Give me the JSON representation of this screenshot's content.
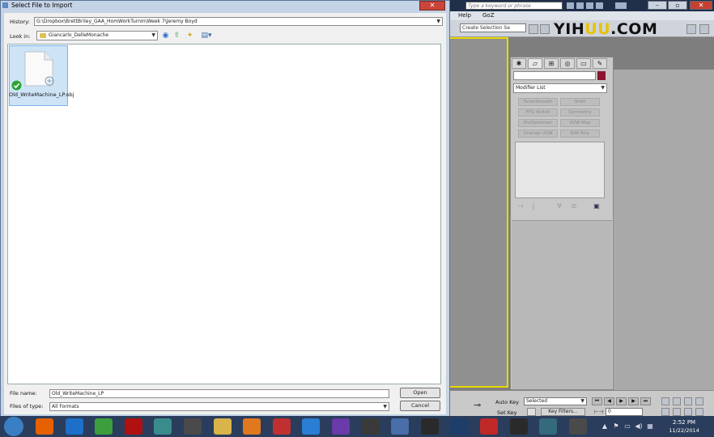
{
  "app": {
    "search_placeholder": "Type a keyword or phrase",
    "menu": [
      "Help",
      "GoZ"
    ],
    "selection_set_placeholder": "Create Selection Se",
    "logo_text": "YIHUU.COM",
    "modifier_list_label": "Modifier List",
    "modifier_buttons": [
      "TurboSmooth",
      "Shell",
      "FFD 4x4x4",
      "Symmetry",
      "ProOptimizer",
      "UVW Map",
      "Unwrap UVW",
      "Edit Poly"
    ],
    "auto_key_label": "Auto Key",
    "set_key_label": "Set Key",
    "selected_option": "Selected",
    "key_filters_label": "Key Filters...",
    "frame_value": "0",
    "viewport_border_color": "#e8d800",
    "object_color": "#8c1430"
  },
  "dialog": {
    "title": "Select File to Import",
    "history_label": "History:",
    "history_value": "G:\\Dropbox\\BrettBriley_GAA_HomWorkTurnIn\\Week 7\\Jeremy Boyd",
    "look_in_label": "Look in:",
    "look_in_value": "Giancarlo_DelleMonache",
    "files": [
      {
        "name": "Old_WriteMachine_LP.obj",
        "icon": "obj-file-icon"
      }
    ],
    "file_name_label": "File name:",
    "file_name_value": "Old_WriteMachine_LP",
    "files_of_type_label": "Files of type:",
    "files_of_type_value": "All Formats",
    "open_label": "Open",
    "cancel_label": "Cancel"
  },
  "taskbar": {
    "apps": [
      {
        "name": "firefox",
        "color": "#e66000"
      },
      {
        "name": "internet-explorer",
        "color": "#1e6fc9"
      },
      {
        "name": "chrome",
        "color": "#3d9e3d"
      },
      {
        "name": "filezilla",
        "color": "#b01010"
      },
      {
        "name": "3ds-max-autodesk",
        "color": "#3a8c8c"
      },
      {
        "name": "media-app",
        "color": "#4a4a4a"
      },
      {
        "name": "file-explorer",
        "color": "#d9b44a"
      },
      {
        "name": "media-player",
        "color": "#e07820"
      },
      {
        "name": "filezilla-alt",
        "color": "#c03030"
      },
      {
        "name": "dropbox",
        "color": "#2a7fd4"
      },
      {
        "name": "app-purple",
        "color": "#6a3aa8"
      },
      {
        "name": "app-dark",
        "color": "#3a3a3a"
      },
      {
        "name": "app-monitor",
        "color": "#4a6ea8"
      },
      {
        "name": "zbrush",
        "color": "#2a2a2a"
      },
      {
        "name": "photoshop",
        "color": "#1d3e6a"
      },
      {
        "name": "app-red",
        "color": "#c02828"
      },
      {
        "name": "app-dark-2",
        "color": "#2a2a2a"
      },
      {
        "name": "3ds-max",
        "color": "#356a7a"
      },
      {
        "name": "app-circle",
        "color": "#4a4a4a"
      }
    ],
    "time": "2:52 PM",
    "date": "11/22/2014"
  }
}
